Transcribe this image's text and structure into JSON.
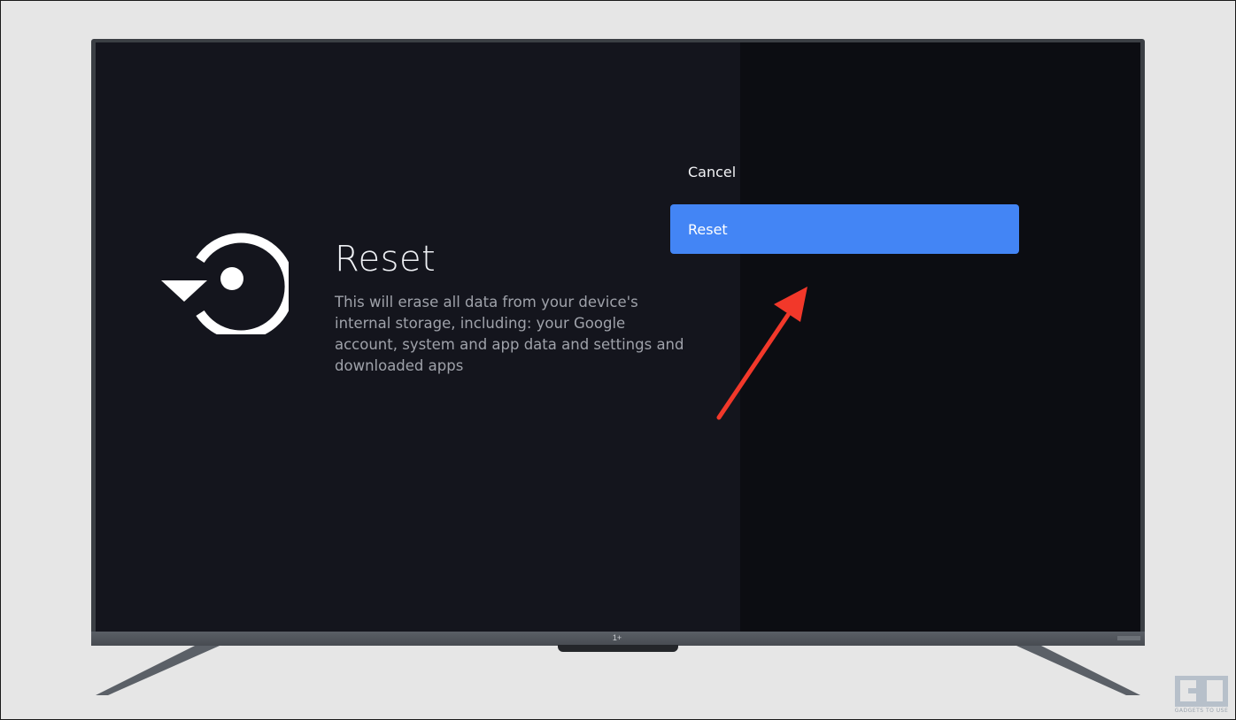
{
  "screen": {
    "title": "Reset",
    "description": "This will erase all data from your device's internal storage, including: your Google account, system and app data and settings and downloaded apps",
    "icon": "restore-icon"
  },
  "options": [
    {
      "label": "Cancel",
      "selected": false
    },
    {
      "label": "Reset",
      "selected": true
    }
  ],
  "colors": {
    "accent": "#4385f5",
    "annotation_arrow": "#f2382a",
    "screen_bg": "#14151d",
    "panel_bg": "#0c0d12"
  },
  "tv": {
    "brand_logo": "oneplus-logo"
  },
  "watermark": {
    "mark": "GU",
    "caption": "GADGETS TO USE"
  }
}
